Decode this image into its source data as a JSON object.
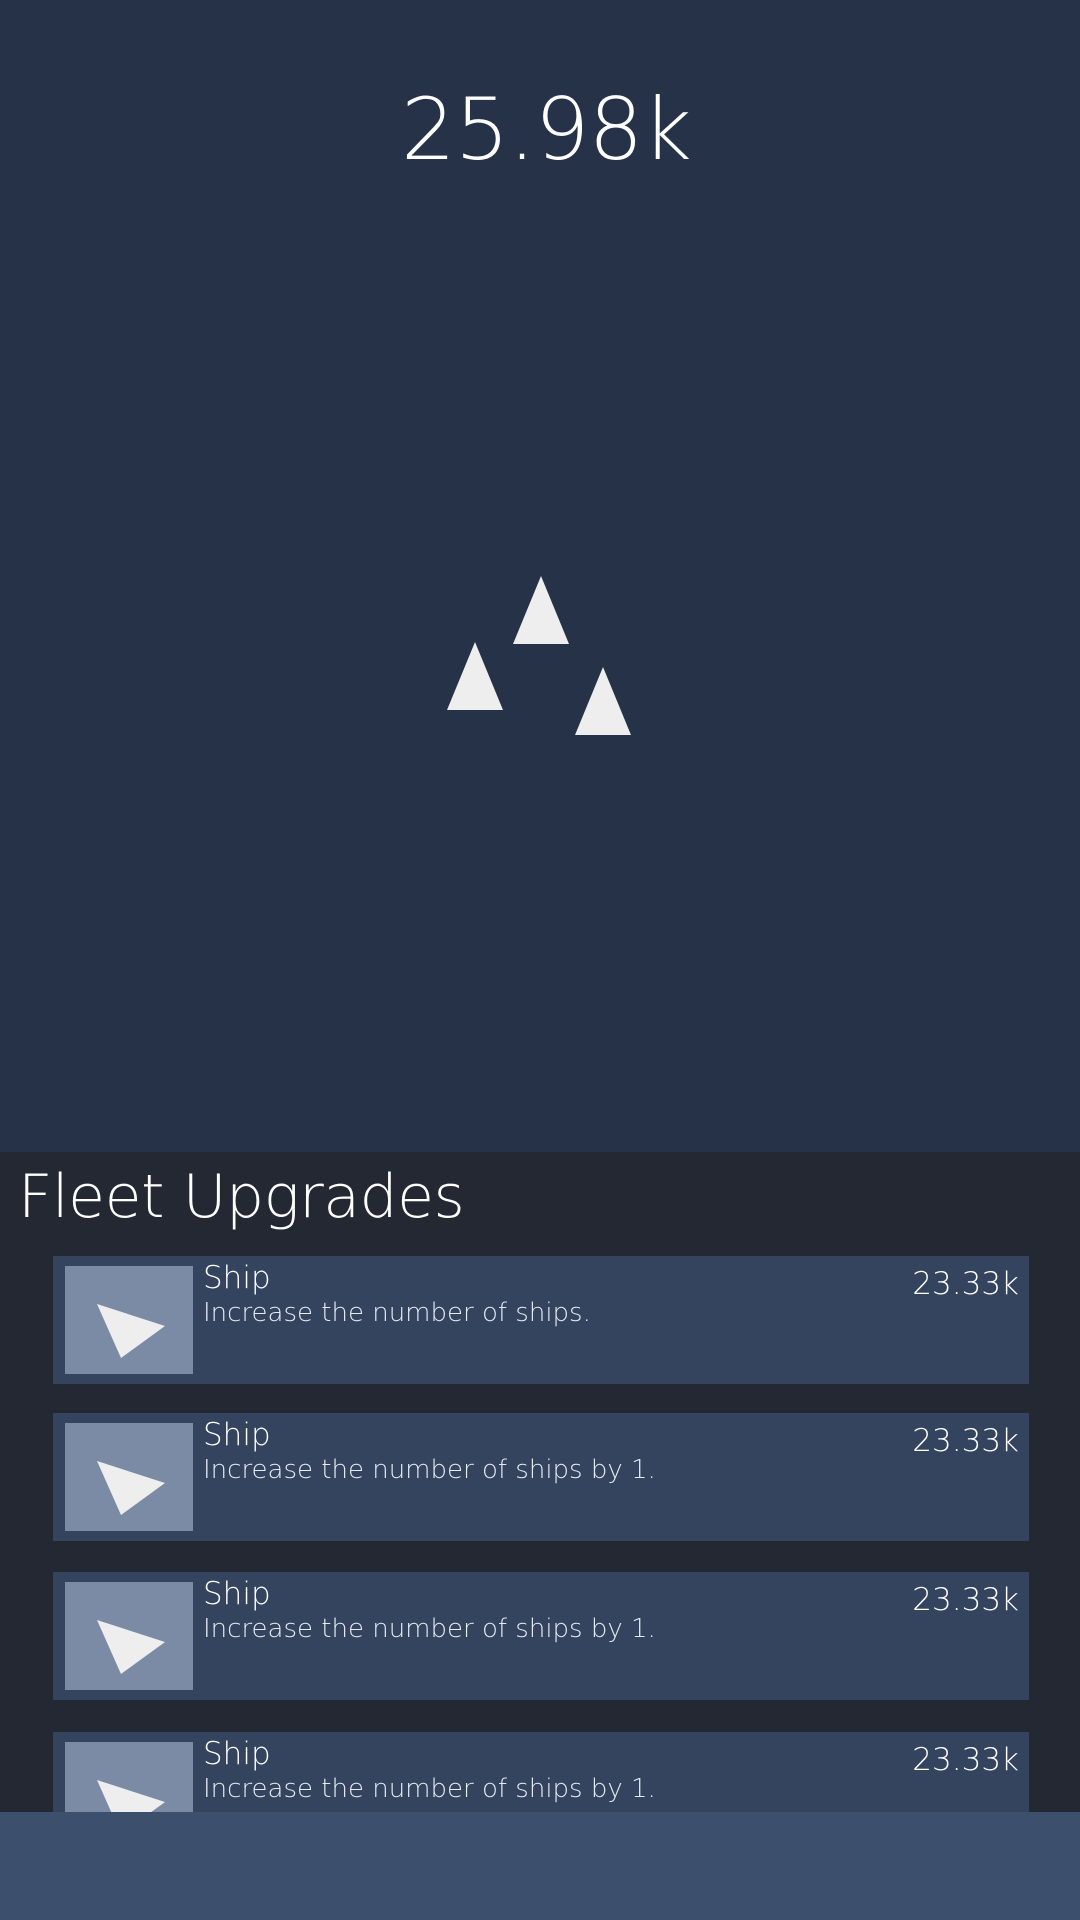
{
  "score": "25.98k",
  "ships_on_screen": 3,
  "upgrades_panel": {
    "title": "Fleet Upgrades",
    "items": [
      {
        "title": "Ship",
        "description": "Increase the number of ships.",
        "cost": "23.33k",
        "icon": "ship-arrow-icon"
      },
      {
        "title": "Ship",
        "description": "Increase the number of ships by 1.",
        "cost": "23.33k",
        "icon": "ship-arrow-icon"
      },
      {
        "title": "Ship",
        "description": "Increase the number of ships by 1.",
        "cost": "23.33k",
        "icon": "ship-arrow-icon"
      },
      {
        "title": "Ship",
        "description": "Increase the number of ships by 1.",
        "cost": "23.33k",
        "icon": "ship-arrow-icon"
      }
    ]
  },
  "colors": {
    "background": "#263247",
    "panel": "#232833",
    "card": "#34445e",
    "thumb": "#7b8aa5",
    "bottom_bar": "#3c4f6d",
    "ship": "#eeeeee"
  }
}
